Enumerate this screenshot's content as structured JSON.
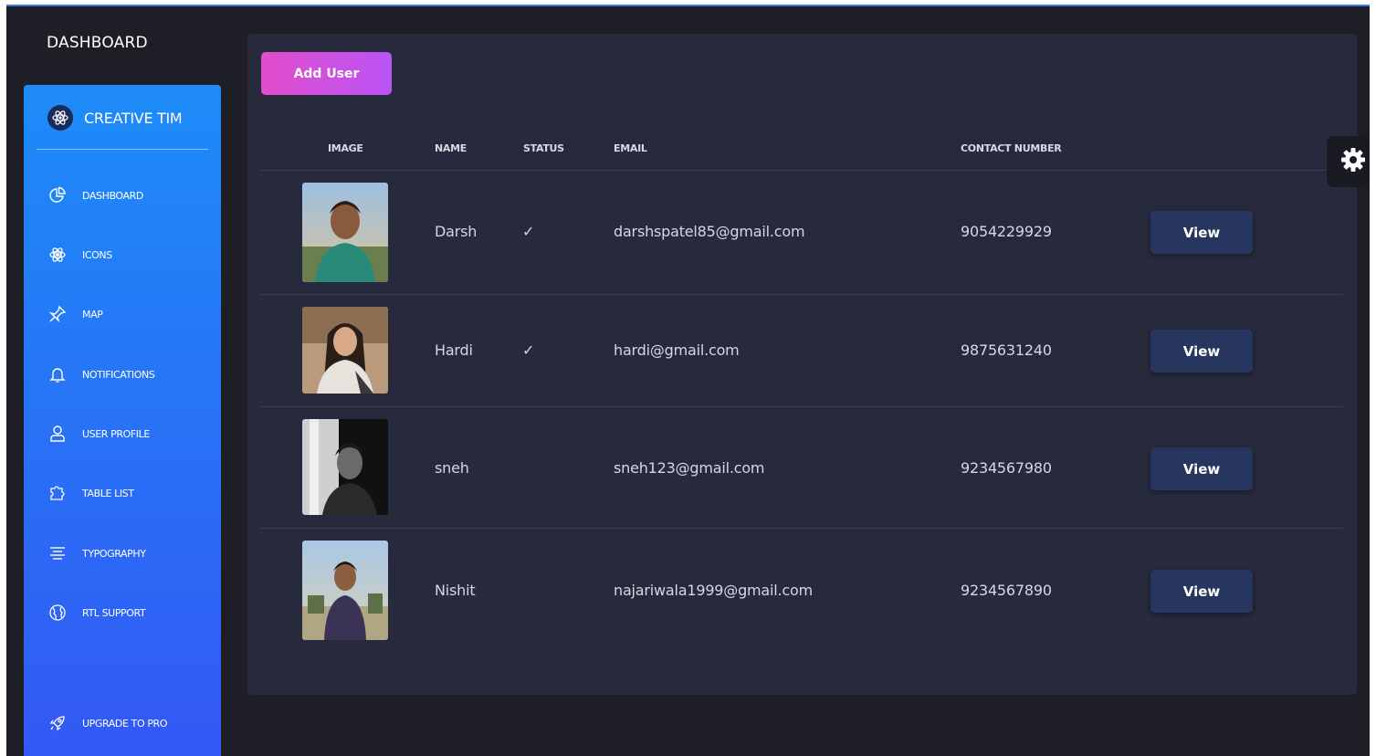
{
  "header": {
    "title": "DASHBOARD"
  },
  "sidebar": {
    "brand": "CREATIVE TIM",
    "items": [
      {
        "label": "DASHBOARD",
        "icon": "chart-pie-icon"
      },
      {
        "label": "ICONS",
        "icon": "atom-icon"
      },
      {
        "label": "MAP",
        "icon": "pin-icon"
      },
      {
        "label": "NOTIFICATIONS",
        "icon": "bell-icon"
      },
      {
        "label": "USER PROFILE",
        "icon": "user-icon"
      },
      {
        "label": "TABLE LIST",
        "icon": "puzzle-icon"
      },
      {
        "label": "TYPOGRAPHY",
        "icon": "align-center-icon"
      },
      {
        "label": "RTL SUPPORT",
        "icon": "world-icon"
      }
    ],
    "upgrade": {
      "label": "UPGRADE TO PRO",
      "icon": "spaceship-icon"
    }
  },
  "main": {
    "add_user_label": "Add User",
    "columns": [
      "IMAGE",
      "NAME",
      "STATUS",
      "EMAIL",
      "CONTACT NUMBER"
    ],
    "rows": [
      {
        "name": "Darsh",
        "status": "✓",
        "email": "darshspatel85@gmail.com",
        "contact": "9054229929",
        "action": "View"
      },
      {
        "name": "Hardi",
        "status": "✓",
        "email": "hardi@gmail.com",
        "contact": "9875631240",
        "action": "View"
      },
      {
        "name": "sneh",
        "status": "",
        "email": "sneh123@gmail.com",
        "contact": "9234567980",
        "action": "View"
      },
      {
        "name": "Nishit",
        "status": "",
        "email": "najariwala1999@gmail.com",
        "contact": "9234567890",
        "action": "View"
      }
    ]
  },
  "colors": {
    "background": "#1e1e26",
    "card": "#27293d",
    "sidebar_gradient_top": "#1d8cf8",
    "sidebar_gradient_bottom": "#3358f4",
    "add_button": "#e14eca",
    "view_button": "#27365e"
  },
  "settings": {
    "icon": "gear-icon"
  }
}
